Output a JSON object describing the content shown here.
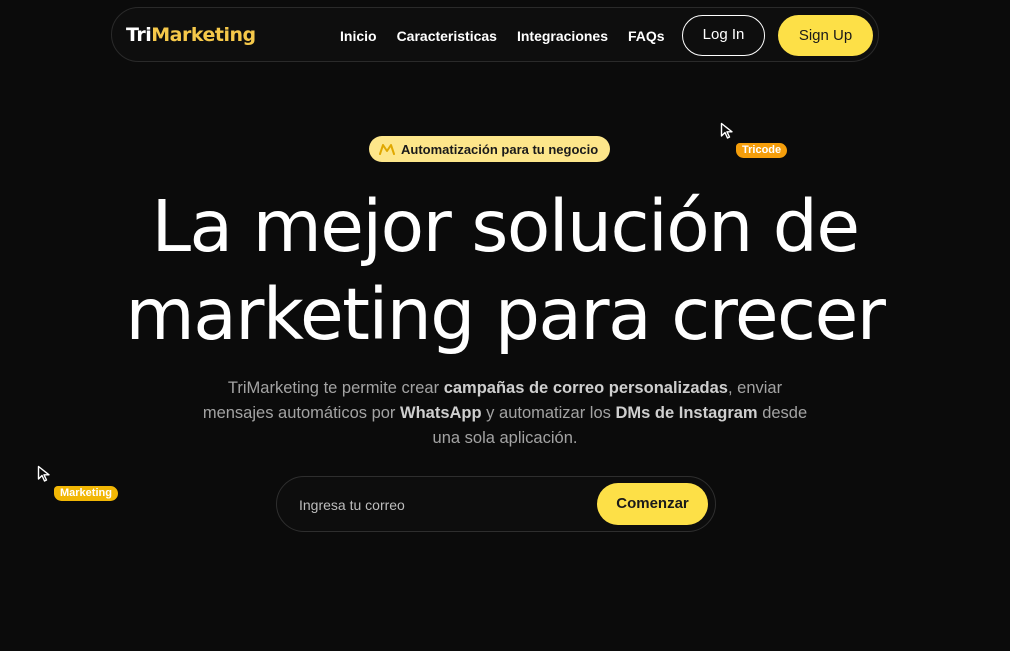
{
  "brand": {
    "logo_part1": "Tri",
    "logo_part2": "Marketing",
    "accent_color": "#fde047"
  },
  "nav": {
    "links": [
      "Inicio",
      "Caracteristicas",
      "Integraciones",
      "FAQs"
    ],
    "login_label": "Log In",
    "signup_label": "Sign Up"
  },
  "badge": {
    "icon": "megaphone-icon",
    "text": "Automatización para tu negocio"
  },
  "cursors": [
    {
      "label": "Tricode",
      "color": "#f59e0b"
    },
    {
      "label": "Marketing",
      "color": "#f2b705"
    }
  ],
  "hero": {
    "title_line1": "La mejor solución de",
    "title_line2": "marketing para crecer",
    "subtitle": {
      "p1": "TriMarketing te permite crear ",
      "b1": "campañas de correo personalizadas",
      "p2": ", enviar mensajes automáticos por ",
      "b2": "WhatsApp",
      "p3": " y automatizar los ",
      "b3": "DMs de Instagram",
      "p4": " desde una sola aplicación."
    }
  },
  "signup_form": {
    "email_placeholder": "Ingresa tu correo",
    "submit_label": "Comenzar"
  }
}
